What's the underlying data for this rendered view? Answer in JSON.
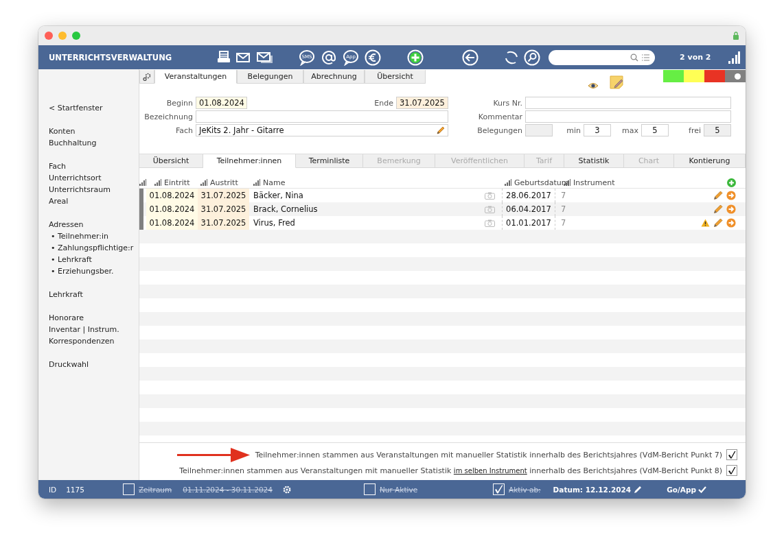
{
  "window": {
    "title": "UNTERRICHTSVERWALTUNG"
  },
  "toolbar": {
    "sms_text": "SMS",
    "app_text": "App",
    "record_counter": "2 von 2"
  },
  "sidebar": {
    "groups": [
      [
        "< Startfenster"
      ],
      [
        "Konten",
        "Buchhaltung"
      ],
      [
        "Fach",
        "Unterrichtsort",
        "Unterrichtsraum",
        "Areal"
      ],
      [
        "Adressen",
        "• Teilnehmer:in",
        "• Zahlungspflichtige:r",
        "• Lehrkraft",
        "• Erziehungsber."
      ],
      [
        "Lehrkraft"
      ],
      [
        "Honorare",
        "Inventar | Instrum.",
        "Korrespondenzen"
      ],
      [
        "Druckwahl"
      ]
    ]
  },
  "top_tabs": [
    {
      "label": "Veranstaltungen",
      "selected": true
    },
    {
      "label": "Belegungen",
      "selected": false
    },
    {
      "label": "Abrechnung",
      "selected": false
    },
    {
      "label": "Übersicht",
      "selected": false
    }
  ],
  "swatches": [
    {
      "color": "#66ee44",
      "kind": "plain"
    },
    {
      "color": "#ffff55",
      "kind": "plain"
    },
    {
      "color": "#e83324",
      "kind": "plain"
    },
    {
      "color": "#808080",
      "kind": "dot"
    }
  ],
  "form": {
    "beginn": {
      "label": "Beginn",
      "value": "01.08.2024",
      "kind": "start"
    },
    "ende": {
      "label": "Ende",
      "value": "31.07.2025",
      "kind": "end"
    },
    "bezeichnung": {
      "label": "Bezeichnung"
    },
    "fach": {
      "label": "Fach",
      "value": "JeKits 2. Jahr - Gitarre"
    },
    "kurs_nr": {
      "label": "Kurs Nr."
    },
    "kommentar": {
      "label": "Kommentar"
    },
    "belegungen": {
      "label": "Belegungen",
      "kind": "readonly"
    },
    "min": {
      "label": "min",
      "value": "3"
    },
    "max": {
      "label": "max",
      "value": "5"
    },
    "frei": {
      "label": "frei",
      "value": "5",
      "kind": "readonly"
    }
  },
  "subtabs": [
    {
      "label": "Übersicht",
      "selected": false,
      "disabled": false
    },
    {
      "label": "Teilnehmer:innen",
      "selected": true,
      "disabled": false
    },
    {
      "label": "Terminliste",
      "selected": false,
      "disabled": false
    },
    {
      "label": "Bemerkung",
      "selected": false,
      "disabled": true
    },
    {
      "label": "Veröffentlichen",
      "selected": false,
      "disabled": true
    },
    {
      "label": "Tarif",
      "selected": false,
      "disabled": true
    },
    {
      "label": "Statistik",
      "selected": false,
      "disabled": false
    },
    {
      "label": "Chart",
      "selected": false,
      "disabled": true
    },
    {
      "label": "Kontierung",
      "selected": false,
      "disabled": false
    }
  ],
  "table": {
    "columns": [
      "Eintritt",
      "Austritt",
      "Name",
      "Geburtsdatum",
      "Instrument"
    ],
    "rows": [
      {
        "eintritt": "01.08.2024",
        "austritt": "31.07.2025",
        "name": "Bäcker, Nina",
        "geburtsdatum": "28.06.2017",
        "column_5": "7",
        "warning": false
      },
      {
        "eintritt": "01.08.2024",
        "austritt": "31.07.2025",
        "name": "Brack, Cornelius",
        "geburtsdatum": "06.04.2017",
        "column_5": "7",
        "warning": false
      },
      {
        "eintritt": "01.08.2024",
        "austritt": "31.07.2025",
        "name": "Virus, Fred",
        "geburtsdatum": "01.01.2017",
        "column_5": "7",
        "warning": true
      }
    ]
  },
  "notes": [
    {
      "text": "Teilnehmer:innen stammen aus Veranstaltungen mit manueller Statistik innerhalb des Berichtsjahres (VdM-Bericht Punkt 7)",
      "arrow": true,
      "checked": true
    },
    {
      "text": "Teilnehmer:innen stammen aus Veranstaltungen mit manueller Statistik",
      "link": "im selben Instrument",
      "text_after": "innerhalb des Berichtsjahres (VdM-Bericht Punkt 8)",
      "arrow": false,
      "checked": true
    }
  ],
  "footer": {
    "id_label": "ID",
    "id": "1175",
    "period": {
      "label": "Zeitraum",
      "range": "01.11.2024 - 30.11.2024",
      "checked": false,
      "struck": true
    },
    "only_active": {
      "label": "Nur Aktive",
      "checked": false,
      "struck": true
    },
    "active_from": {
      "label": "Aktiv ab:",
      "checked": true,
      "struck": true
    },
    "date": "Datum: 12.12.2024",
    "go": "Go/App"
  }
}
